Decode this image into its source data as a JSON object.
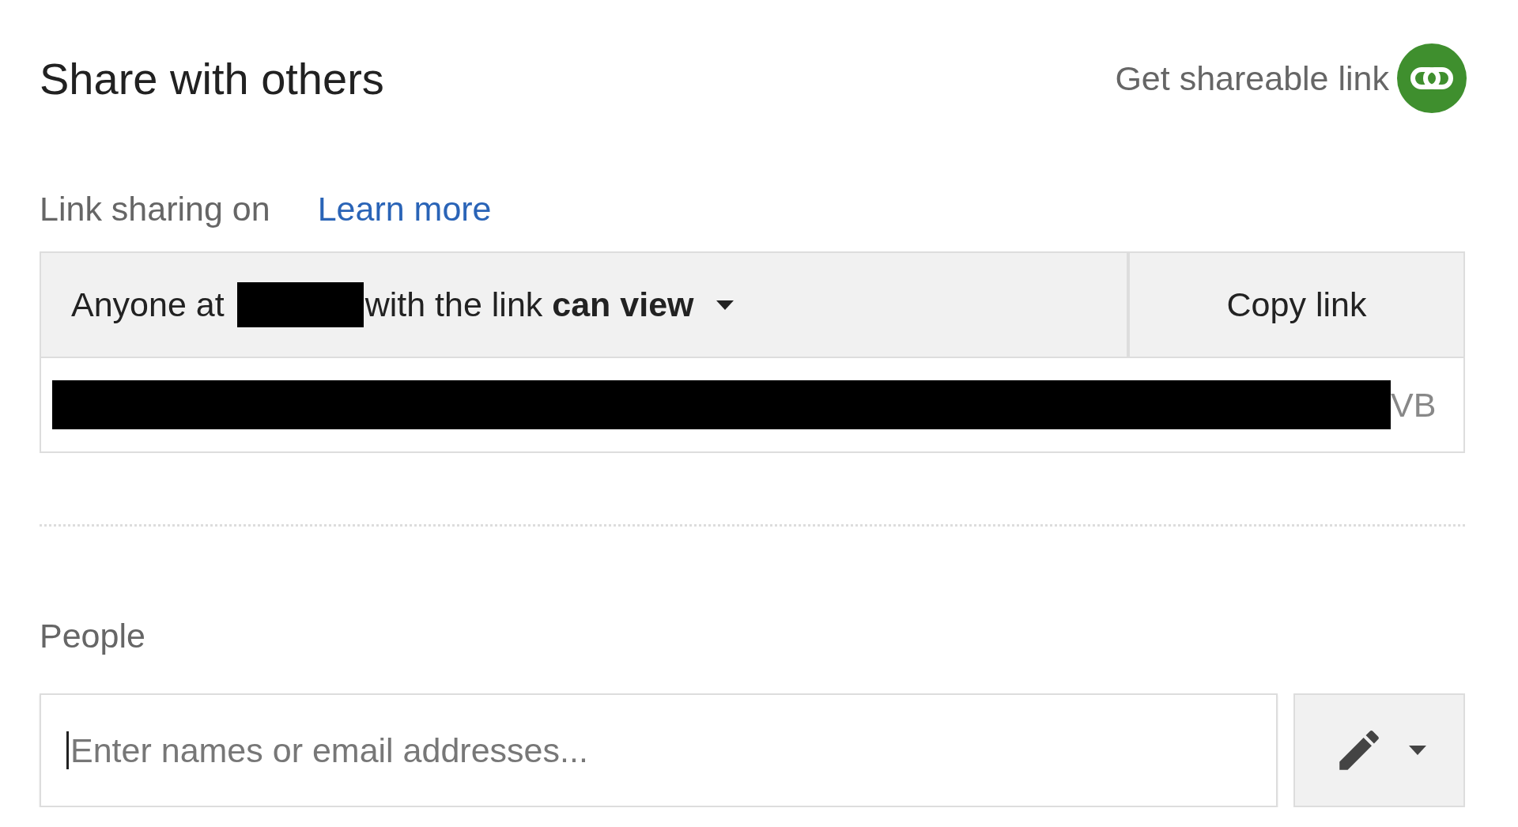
{
  "header": {
    "title": "Share with others",
    "shareable_link": {
      "label": "Get shareable link",
      "on": true
    }
  },
  "link_sharing": {
    "status": "Link sharing on",
    "learn_more": "Learn more",
    "access_prefix": "Anyone at",
    "access_text": "with the link **can view**",
    "copy_button": "Copy link",
    "url_tail": "VB"
  },
  "people": {
    "label": "People",
    "placeholder": "Enter names or email addresses..."
  }
}
